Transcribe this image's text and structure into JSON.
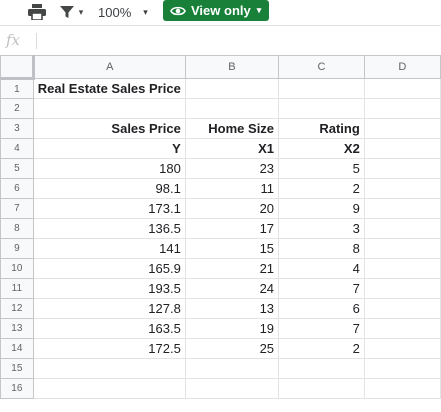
{
  "toolbar": {
    "print_icon": "print-icon",
    "filter_icon": "filter-icon",
    "filter_caret": "▾",
    "zoom": "100%",
    "zoom_caret": "▾",
    "view_mode_label": "View only",
    "view_mode_color": "#188038",
    "view_mode_caret": "▾"
  },
  "formula_bar": {
    "fx": "fx",
    "value": ""
  },
  "sheet": {
    "columns": [
      "A",
      "B",
      "C",
      "D"
    ],
    "rows": [
      {
        "n": "1",
        "a": "Real Estate Sales Price",
        "b": "",
        "c": ""
      },
      {
        "n": "2",
        "a": "",
        "b": "",
        "c": ""
      },
      {
        "n": "3",
        "a": "Sales Price",
        "b": "Home Size",
        "c": "Rating"
      },
      {
        "n": "4",
        "a": "Y",
        "b": "X1",
        "c": "X2"
      },
      {
        "n": "5",
        "a": "180",
        "b": "23",
        "c": "5"
      },
      {
        "n": "6",
        "a": "98.1",
        "b": "11",
        "c": "2"
      },
      {
        "n": "7",
        "a": "173.1",
        "b": "20",
        "c": "9"
      },
      {
        "n": "8",
        "a": "136.5",
        "b": "17",
        "c": "3"
      },
      {
        "n": "9",
        "a": "141",
        "b": "15",
        "c": "8"
      },
      {
        "n": "10",
        "a": "165.9",
        "b": "21",
        "c": "4"
      },
      {
        "n": "11",
        "a": "193.5",
        "b": "24",
        "c": "7"
      },
      {
        "n": "12",
        "a": "127.8",
        "b": "13",
        "c": "6"
      },
      {
        "n": "13",
        "a": "163.5",
        "b": "19",
        "c": "7"
      },
      {
        "n": "14",
        "a": "172.5",
        "b": "25",
        "c": "2"
      },
      {
        "n": "15",
        "a": "",
        "b": "",
        "c": ""
      },
      {
        "n": "16",
        "a": "",
        "b": "",
        "c": ""
      }
    ]
  }
}
